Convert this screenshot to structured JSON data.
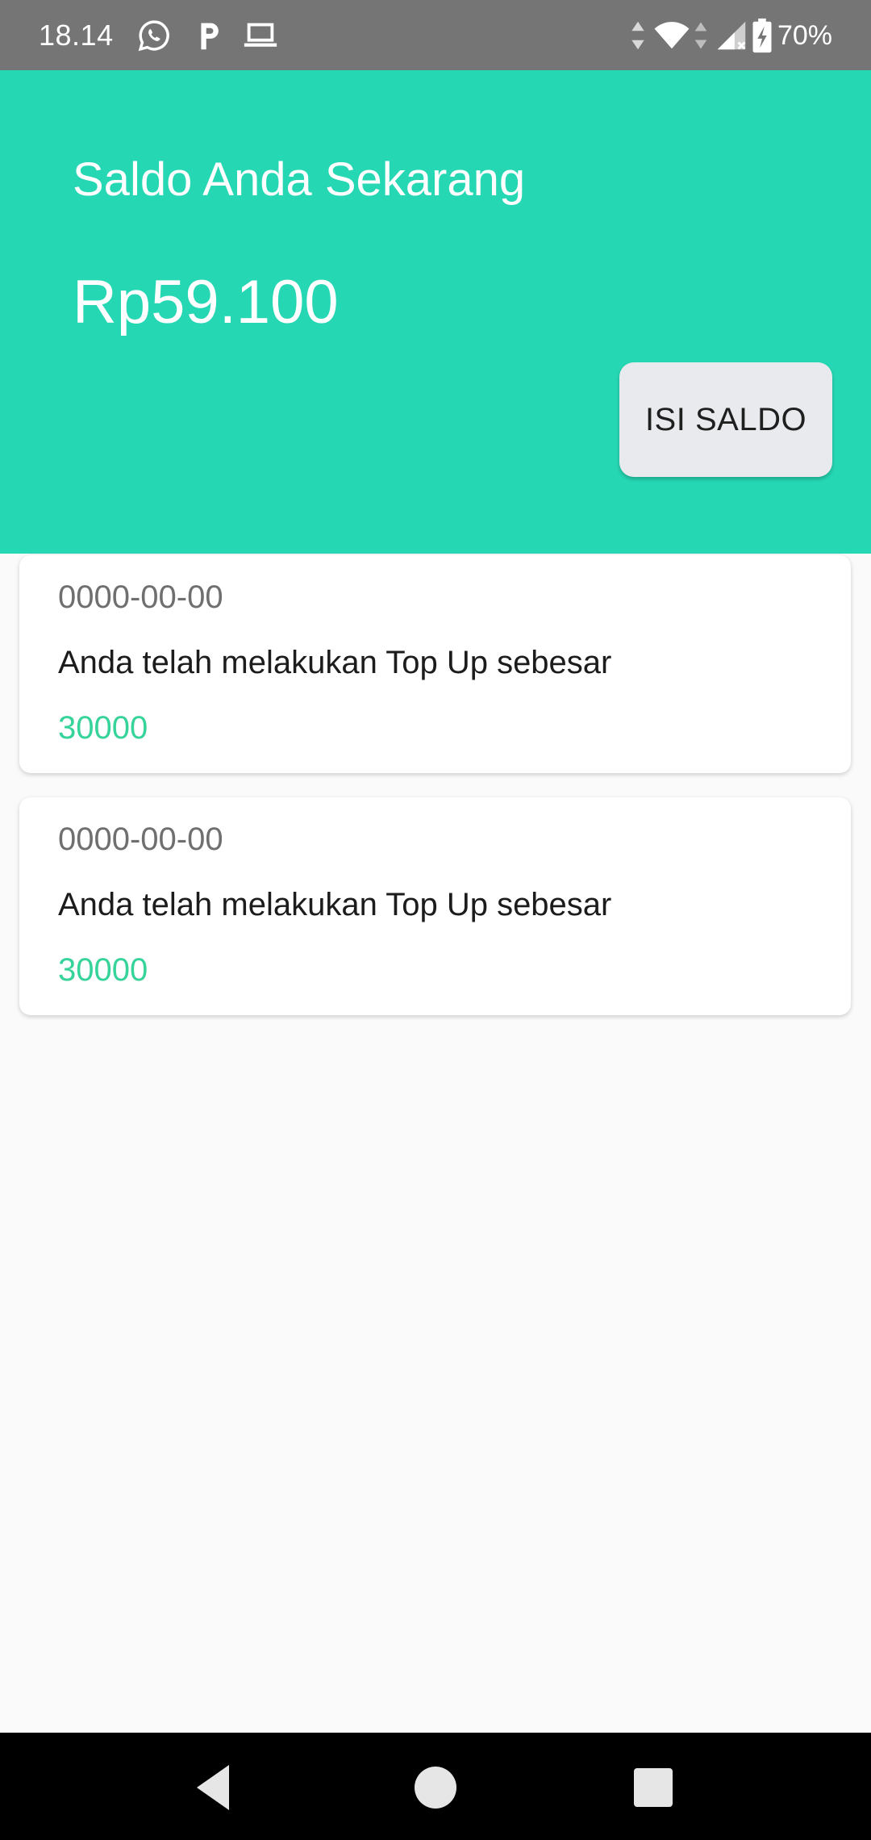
{
  "status_bar": {
    "time": "18.14",
    "battery_percent": "70%",
    "icons": [
      "whatsapp-icon",
      "p-app-icon",
      "laptop-icon",
      "data-arrows-icon",
      "wifi-icon",
      "cell-signal-icon",
      "battery-icon"
    ]
  },
  "header": {
    "title": "Saldo Anda Sekarang",
    "balance": "Rp59.100",
    "topup_button_label": "ISI SALDO",
    "background_color": "#26d7b4"
  },
  "transactions": [
    {
      "date": "0000-00-00",
      "description": "Anda telah melakukan Top Up sebesar",
      "amount": "30000"
    },
    {
      "date": "0000-00-00",
      "description": "Anda telah melakukan Top Up sebesar",
      "amount": "30000"
    }
  ],
  "colors": {
    "accent": "#26d7b4",
    "amount_text": "#36d39a",
    "status_bar": "#757575",
    "button_bg": "#e9eaee"
  },
  "nav_bar": {
    "icons": [
      "back-icon",
      "home-icon",
      "recents-icon"
    ]
  }
}
